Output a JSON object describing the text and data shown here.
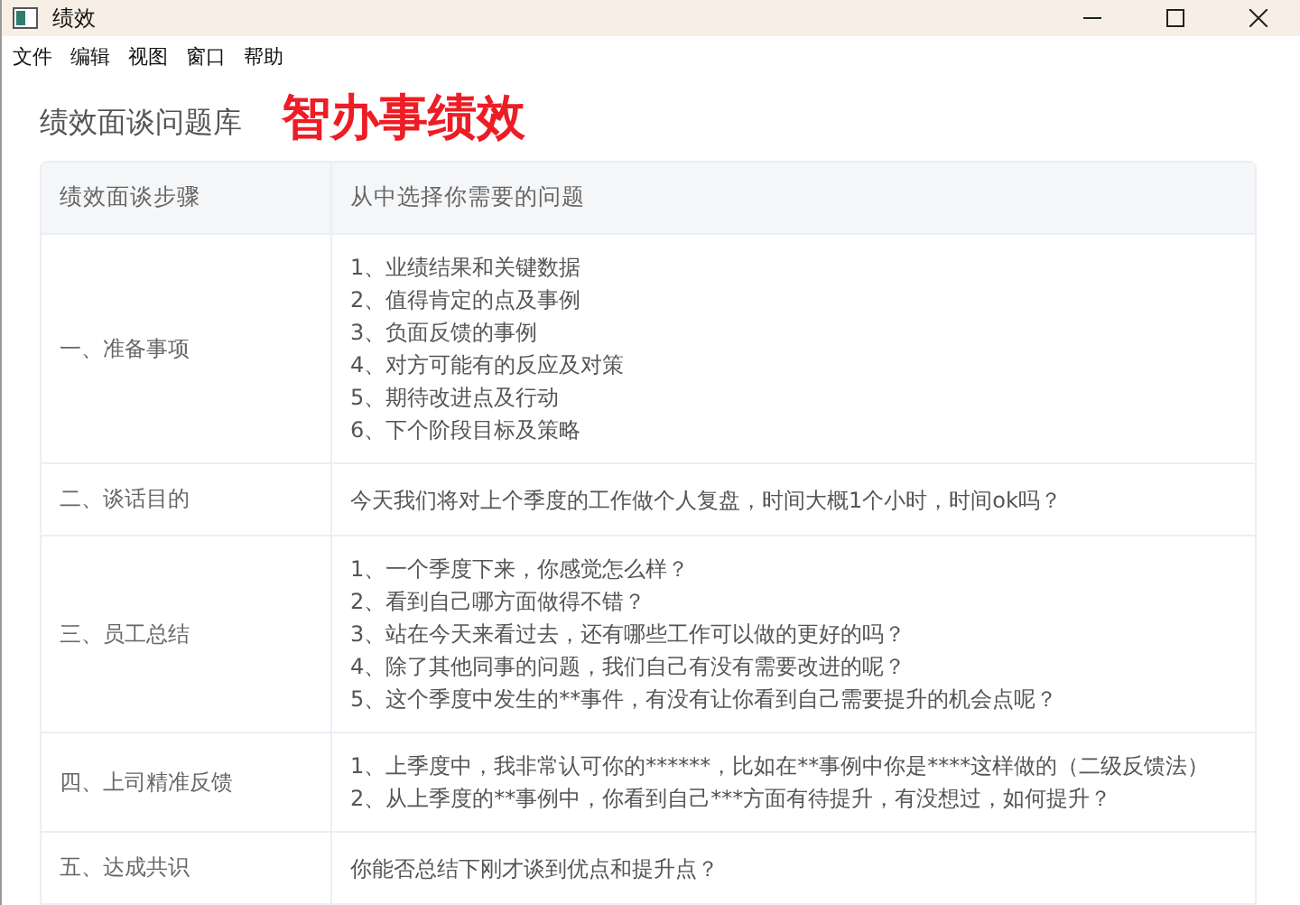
{
  "window": {
    "title": "绩效"
  },
  "menu": [
    "文件",
    "编辑",
    "视图",
    "窗口",
    "帮助"
  ],
  "header": {
    "title": "绩效面谈问题库",
    "brand": "智办事绩效"
  },
  "table": {
    "columns": [
      "绩效面谈步骤",
      "从中选择你需要的问题"
    ],
    "rows": [
      {
        "step": "一、准备事项",
        "lines": [
          "1、业绩结果和关键数据",
          "2、值得肯定的点及事例",
          "3、负面反馈的事例",
          "4、对方可能有的反应及对策",
          "5、期待改进点及行动",
          "6、下个阶段目标及策略"
        ]
      },
      {
        "step": "二、谈话目的",
        "lines": [
          "今天我们将对上个季度的工作做个人复盘，时间大概1个小时，时间ok吗？"
        ]
      },
      {
        "step": "三、员工总结",
        "lines": [
          "1、一个季度下来，你感觉怎么样？",
          "2、看到自己哪方面做得不错？",
          "3、站在今天来看过去，还有哪些工作可以做的更好的吗？",
          "4、除了其他同事的问题，我们自己有没有需要改进的呢？",
          "5、这个季度中发生的**事件，有没有让你看到自己需要提升的机会点呢？"
        ]
      },
      {
        "step": "四、上司精准反馈",
        "lines": [
          "1、上季度中，我非常认可你的******，比如在**事例中你是****这样做的（二级反馈法）",
          "2、从上季度的**事例中，你看到自己***方面有待提升，有没想过，如何提升？"
        ]
      },
      {
        "step": "五、达成共识",
        "lines": [
          "你能否总结下刚才谈到优点和提升点？"
        ]
      }
    ]
  }
}
